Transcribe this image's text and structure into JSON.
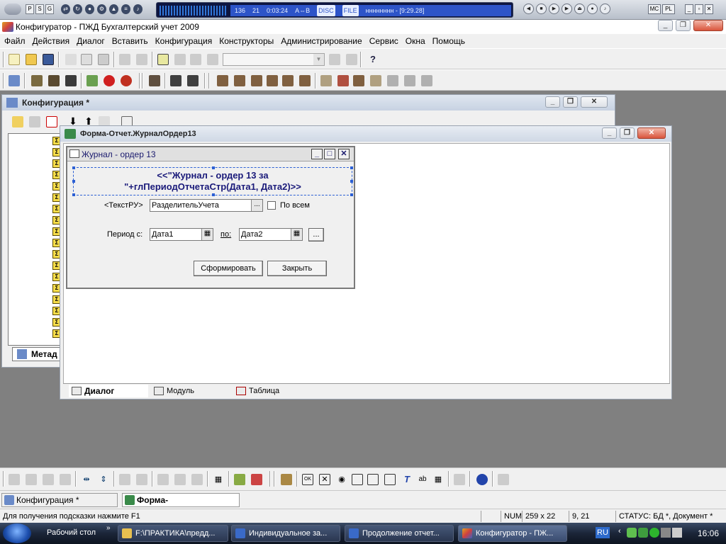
{
  "media_player": {
    "left_buttons": [
      "P",
      "S",
      "G",
      "S"
    ],
    "display": {
      "track_info": "136",
      "channels": "21",
      "time": "0:03:24",
      "mode": "A⇔B",
      "disc": "DISC",
      "file": "FILE",
      "title": "нннннннн - [9:29.28]"
    },
    "right_buttons": [
      "MC",
      "PL"
    ]
  },
  "app": {
    "title": "Конфигуратор - ПЖД Бухгалтерский учет 2009",
    "menu": [
      "Файл",
      "Действия",
      "Диалог",
      "Вставить",
      "Конфигурация",
      "Конструкторы",
      "Администрирование",
      "Сервис",
      "Окна",
      "Помощь"
    ]
  },
  "config_window": {
    "title": "Конфигурация *",
    "tab_label": "Метад",
    "tree_item_glyph": "Σ"
  },
  "form_window": {
    "title": "Форма-Отчет.ЖурналОрдер13",
    "tabs": [
      "Диалог",
      "Модуль",
      "Таблица"
    ]
  },
  "dialog": {
    "title": "Журнал - ордер 13",
    "heading_line1": "<<\"Журнал - ордер 13 за",
    "heading_line2": "\"+глПериодОтчетаСтр(Дата1, Дата2)>>",
    "text_label": "<ТекстРУ>",
    "text_value": "РазделительУчета",
    "checkbox_label": "По всем",
    "period_from_label": "Период с:",
    "date1": "Дата1",
    "period_to_label": "по:",
    "date2": "Дата2",
    "ellipsis": "...",
    "btn_generate": "Сформировать",
    "btn_close": "Закрыть"
  },
  "mdi_tabs": [
    "Конфигурация *",
    "Форма-Отчет.ЖурналО..."
  ],
  "statusbar": {
    "hint": "Для получения подсказки нажмите F1",
    "num": "NUM",
    "size": "259 x 22",
    "pos": "9, 21",
    "status": "СТАТУС: БД *, Документ *"
  },
  "taskbar": {
    "items": [
      "Рабочий стол",
      "F:\\ПРАКТИКА\\предд...",
      "Индивидуальное за...",
      "Продолжение отчет...",
      "Конфигуратор - ПЖ..."
    ],
    "lang": "RU",
    "clock": "16:06"
  }
}
